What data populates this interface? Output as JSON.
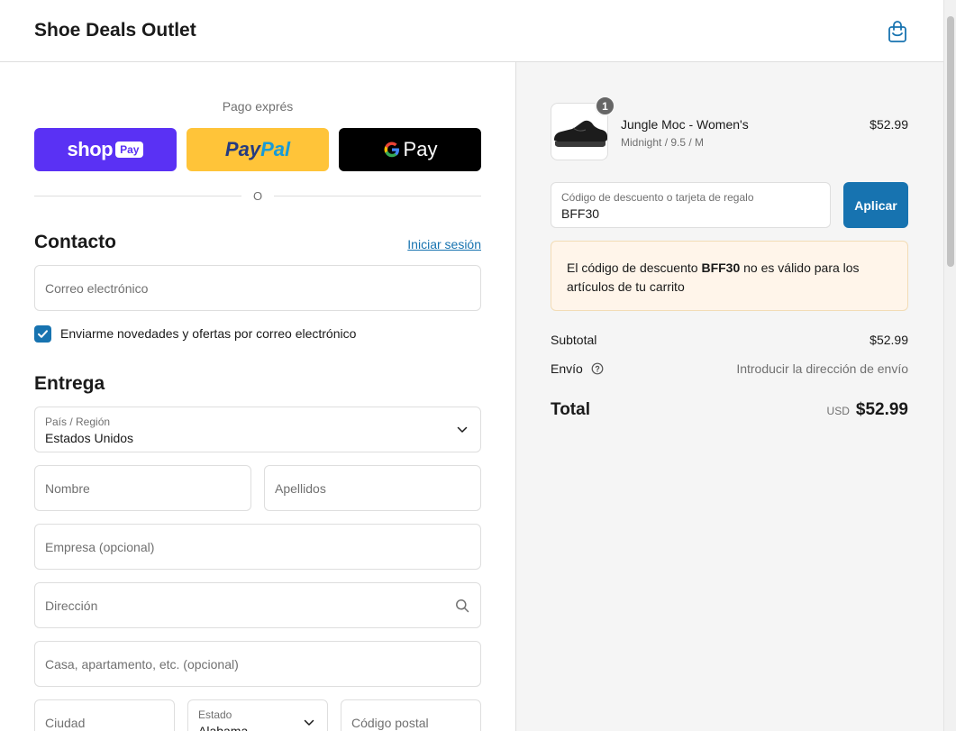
{
  "header": {
    "store_name": "Shoe Deals Outlet"
  },
  "express": {
    "label": "Pago exprés",
    "shop_word": "shop",
    "shop_badge": "Pay",
    "paypal_part1": "Pay",
    "paypal_part2": "Pal",
    "gpay_g": "G",
    "gpay_word": "Pay",
    "divider": "O"
  },
  "contact": {
    "title": "Contacto",
    "login_link": "Iniciar sesión",
    "email_placeholder": "Correo electrónico",
    "newsletter_label": "Enviarme novedades y ofertas por correo electrónico",
    "newsletter_checked": true
  },
  "delivery": {
    "title": "Entrega",
    "country_label": "País / Región",
    "country_value": "Estados Unidos",
    "first_name": "Nombre",
    "last_name": "Apellidos",
    "company": "Empresa (opcional)",
    "address": "Dirección",
    "apartment": "Casa, apartamento, etc. (opcional)",
    "city": "Ciudad",
    "state_label": "Estado",
    "state_value": "Alabama",
    "zip": "Código postal"
  },
  "cart": {
    "quantity": "1",
    "product_name": "Jungle Moc - Women's",
    "product_variant": "Midnight / 9.5 / M",
    "product_price": "$52.99"
  },
  "discount": {
    "label": "Código de descuento o tarjeta de regalo",
    "value": "BFF30",
    "apply_label": "Aplicar",
    "error_prefix": "El código de descuento ",
    "error_code": "BFF30",
    "error_suffix": " no es válido para los artículos de tu carrito"
  },
  "summary": {
    "subtotal_label": "Subtotal",
    "subtotal_value": "$52.99",
    "shipping_label": "Envío",
    "shipping_value": "Introducir la dirección de envío",
    "total_label": "Total",
    "currency": "USD",
    "total_value": "$52.99"
  },
  "colors": {
    "accent": "#1773b0",
    "shop_pay": "#5a31f4",
    "paypal": "#ffc439",
    "error_bg": "#fff5ea"
  }
}
